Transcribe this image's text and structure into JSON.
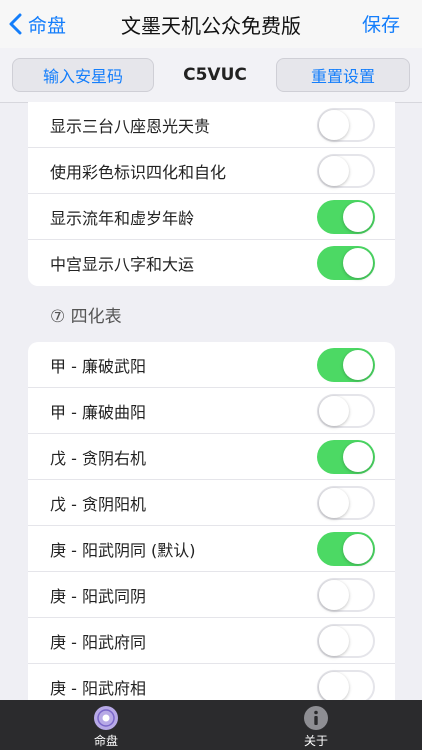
{
  "nav": {
    "back_label": "命盘",
    "title": "文墨天机公众免费版",
    "save_label": "保存"
  },
  "toolbar": {
    "left_button": "输入安星码",
    "code": "C5VUC",
    "right_button": "重置设置"
  },
  "settings_top": [
    {
      "label": "显示三台八座恩光天贵",
      "on": false
    },
    {
      "label": "使用彩色标识四化和自化",
      "on": false
    },
    {
      "label": "显示流年和虚岁年龄",
      "on": true
    },
    {
      "label": "中宫显示八字和大运",
      "on": true
    }
  ],
  "section_title": "⑦ 四化表",
  "sihua_rows": [
    {
      "label": "甲 - 廉破武阳",
      "on": true
    },
    {
      "label": "甲 - 廉破曲阳",
      "on": false
    },
    {
      "label": "戊 - 贪阴右机",
      "on": true
    },
    {
      "label": "戊 - 贪阴阳机",
      "on": false
    },
    {
      "label": "庚 - 阳武阴同 (默认)",
      "on": true
    },
    {
      "label": "庚 - 阳武同阴",
      "on": false
    },
    {
      "label": "庚 - 阳武府同",
      "on": false
    },
    {
      "label": "庚 - 阳武府相",
      "on": false
    }
  ],
  "tabbar": {
    "home_label": "命盘",
    "about_label": "关于"
  },
  "colors": {
    "accent": "#147efb",
    "toggle_on": "#4cd964",
    "tabbar_bg": "#2b2b2d"
  }
}
